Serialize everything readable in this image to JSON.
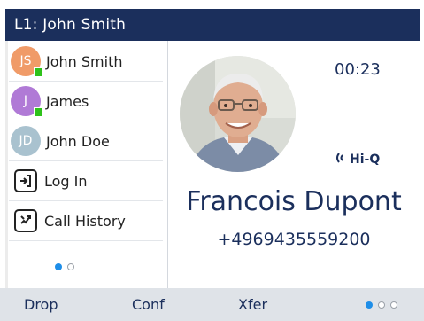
{
  "header": {
    "title": "L1: John Smith"
  },
  "sidebar": {
    "items": [
      {
        "initials": "JS",
        "label": "John Smith",
        "avatar_color": "#f09b68",
        "presence": "available"
      },
      {
        "initials": "J",
        "label": "James",
        "avatar_color": "#b07ad6",
        "presence": "available"
      },
      {
        "initials": "JD",
        "label": "John Doe",
        "avatar_color": "#a9c2cf",
        "presence": "none"
      },
      {
        "icon": "login-icon",
        "label": "Log In"
      },
      {
        "icon": "call-history-icon",
        "label": "Call History"
      }
    ],
    "page_indicator": {
      "current": 1,
      "total": 2
    }
  },
  "call": {
    "timer": "00:23",
    "codec_badge": "Hi-Q",
    "caller_name": "Francois Dupont",
    "caller_number": "+4969435559200"
  },
  "softkeys": {
    "items": [
      "Drop",
      "Conf",
      "Xfer"
    ],
    "page_indicator": {
      "current": 1,
      "total": 3
    }
  },
  "colors": {
    "titlebar": "#1b2f5c",
    "presence_available": "#2ec21a",
    "accent_dot": "#1e8ee8",
    "softkey_bar": "#dfe3e8"
  }
}
